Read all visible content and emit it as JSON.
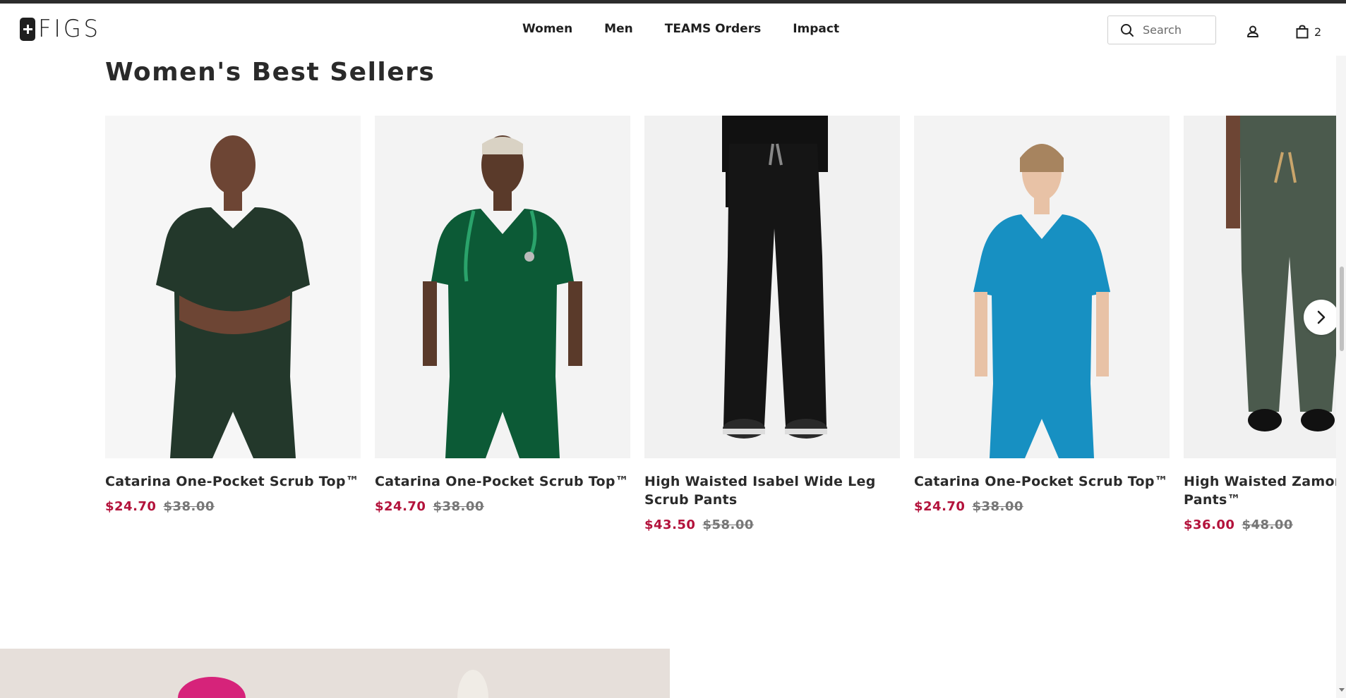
{
  "header": {
    "logo_text": "FIGS",
    "nav": [
      "Women",
      "Men",
      "TEAMS Orders",
      "Impact"
    ],
    "search_placeholder": "Search",
    "cart_count": "2"
  },
  "section": {
    "title": "Women's Best Sellers"
  },
  "products": [
    {
      "name": "Catarina One-Pocket Scrub Top™",
      "sale_price": "$24.70",
      "original_price": "$38.00",
      "color": "#23382b"
    },
    {
      "name": "Catarina One-Pocket Scrub Top™",
      "sale_price": "$24.70",
      "original_price": "$38.00",
      "color": "#0c5a36"
    },
    {
      "name": "High Waisted Isabel Wide Leg Scrub Pants",
      "sale_price": "$43.50",
      "original_price": "$58.00",
      "color": "#151515"
    },
    {
      "name": "Catarina One-Pocket Scrub Top™",
      "sale_price": "$24.70",
      "original_price": "$38.00",
      "color": "#1790c2"
    },
    {
      "name": "High Waisted Zamora Jo\nPants™",
      "sale_price": "$36.00",
      "original_price": "$48.00",
      "color": "#4b5a4d"
    }
  ],
  "colors": {
    "sale": "#b3123b",
    "strikethrough": "#777777",
    "banner": "#e6dfda"
  }
}
